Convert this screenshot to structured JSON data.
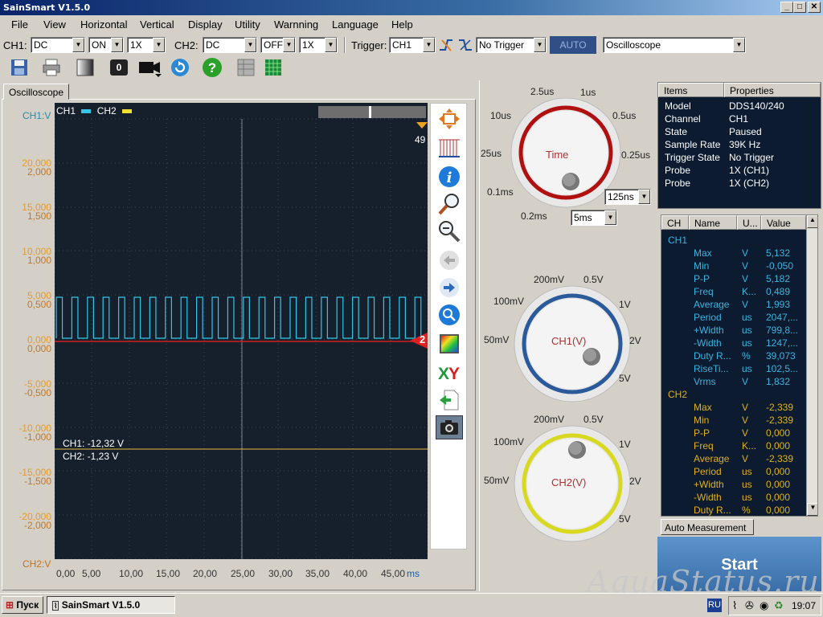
{
  "window": {
    "title": "SainSmart V1.5.0",
    "buttons": [
      "_",
      "□",
      "✕"
    ]
  },
  "menu": [
    "File",
    "View",
    "Horizontal",
    "Vertical",
    "Display",
    "Utility",
    "Warnning",
    "Language",
    "Help"
  ],
  "toolbar": {
    "ch1_label": "CH1:",
    "ch1_coupling": "DC",
    "ch1_state": "ON",
    "ch1_probe": "1X",
    "ch2_label": "CH2:",
    "ch2_coupling": "DC",
    "ch2_state": "OFF",
    "ch2_probe": "1X",
    "trigger_label": "Trigger:",
    "trigger_source": "CH1",
    "trigger_mode": "No Trigger",
    "auto_label": "AUTO",
    "instrument": "Oscilloscope"
  },
  "toolbar2": {
    "counter": "0"
  },
  "osc_tab": "Oscilloscope",
  "scope": {
    "legend_ch1": "CH1",
    "legend_ch2": "CH2",
    "ch1_axis_label": "CH1:V",
    "ch2_axis_label": "CH2:V",
    "trigger_pos_label": "49",
    "marker_label": "2",
    "cursor_ch1": "CH1: -12,32 V",
    "cursor_ch2": "CH2: -1,23 V",
    "y_labels_ch1": [
      "20,000",
      "15,000",
      "10,000",
      "5,000",
      "0,000",
      "-5,000",
      "-10,000",
      "-15,000",
      "-20,000"
    ],
    "y_labels_ch2": [
      "2,000",
      "1,500",
      "1,000",
      "0,500",
      "0,000",
      "-0,500",
      "-1,000",
      "-1,500",
      "-2,000"
    ],
    "x_labels": [
      "0,00",
      "5,00",
      "10,00",
      "15,00",
      "20,00",
      "25,00",
      "30,00",
      "35,00",
      "40,00",
      "45,00"
    ],
    "x_unit": "ms",
    "ch1_color": "#33c6e8",
    "ch2_color": "#f0e030"
  },
  "time_knob": {
    "center_label": "Time",
    "labels": [
      "2.5us",
      "1us",
      "10us",
      "0.5us",
      "25us",
      "0.25us",
      "0.1ms",
      "0.2ms"
    ],
    "combo1": "125ns",
    "combo2": "5ms",
    "ring_color": "#b01010"
  },
  "ch1_knob": {
    "center_label": "CH1(V)",
    "labels": [
      "200mV",
      "0.5V",
      "100mV",
      "1V",
      "50mV",
      "2V",
      "5V"
    ],
    "ring_color": "#2a5a9a"
  },
  "ch2_knob": {
    "center_label": "CH2(V)",
    "labels": [
      "200mV",
      "0.5V",
      "100mV",
      "1V",
      "50mV",
      "2V",
      "5V"
    ],
    "ring_color": "#d8d820"
  },
  "properties": {
    "headers": [
      "Items",
      "Properties"
    ],
    "rows": [
      [
        "Model",
        "DDS140/240"
      ],
      [
        "Channel",
        "CH1"
      ],
      [
        "State",
        "Paused"
      ],
      [
        "Sample Rate",
        "39K Hz"
      ],
      [
        "Trigger State",
        "No Trigger"
      ],
      [
        "Probe",
        "1X (CH1)"
      ],
      [
        "Probe",
        "1X (CH2)"
      ]
    ]
  },
  "measurement": {
    "headers": [
      "CH",
      "Name",
      "U...",
      "Value"
    ],
    "ch1_title": "CH1",
    "ch2_title": "CH2",
    "ch1_rows": [
      [
        "Max",
        "V",
        "5,132"
      ],
      [
        "Min",
        "V",
        "-0,050"
      ],
      [
        "P-P",
        "V",
        "5,182"
      ],
      [
        "Freq",
        "K...",
        "0,489"
      ],
      [
        "Average",
        "V",
        "1,993"
      ],
      [
        "Period",
        "us",
        "2047,..."
      ],
      [
        "+Width",
        "us",
        "799,8..."
      ],
      [
        "-Width",
        "us",
        "1247,..."
      ],
      [
        "Duty R...",
        "%",
        "39,073"
      ],
      [
        "RiseTi...",
        "us",
        "102,5..."
      ],
      [
        "Vrms",
        "V",
        "1,832"
      ]
    ],
    "ch2_rows": [
      [
        "Max",
        "V",
        "-2,339"
      ],
      [
        "Min",
        "V",
        "-2,339"
      ],
      [
        "P-P",
        "V",
        "0,000"
      ],
      [
        "Freq",
        "K...",
        "0,000"
      ],
      [
        "Average",
        "V",
        "-2,339"
      ],
      [
        "Period",
        "us",
        "0,000"
      ],
      [
        "+Width",
        "us",
        "0,000"
      ],
      [
        "-Width",
        "us",
        "0,000"
      ],
      [
        "Duty R...",
        "%",
        "0,000"
      ]
    ],
    "tab_label": "Auto Measurement"
  },
  "start_label": "Start",
  "watermark": "AquaStatus.ru",
  "taskbar": {
    "start_label": "Пуск",
    "task_label": "SainSmart V1.5.0",
    "lang": "RU",
    "time": "19:07"
  }
}
